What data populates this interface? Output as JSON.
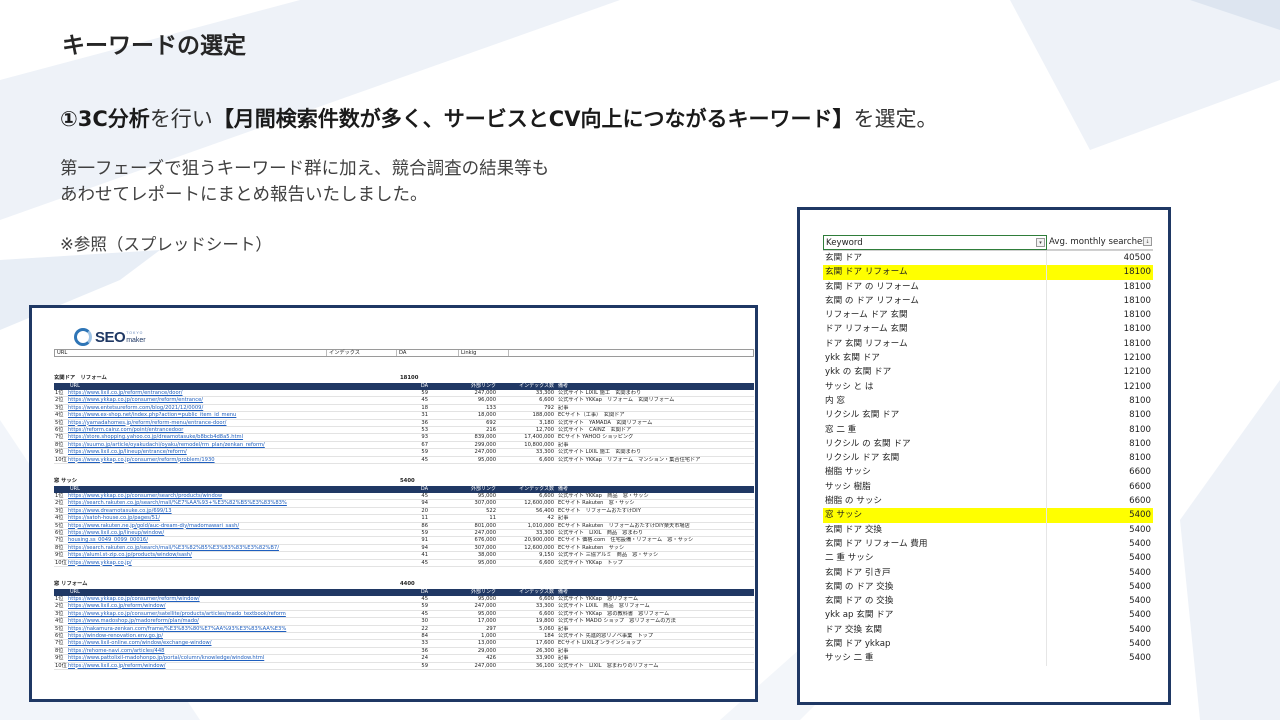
{
  "slide": {
    "title": "キーワードの選定",
    "headline": {
      "bold1": "①3C分析",
      "normal1": "を行い",
      "bold2": "【月間検索件数が多く、サービスとCV向上につながるキーワード】",
      "normal2": "を選定。"
    },
    "desc_line1": "第一フェーズで狙うキーワード群に加え、競合調査の結果等も",
    "desc_line2": "あわせてレポートにまとめ報告いたしました。",
    "note": "※参照（スプレッドシート）"
  },
  "sheet": {
    "logo_text": "SEO",
    "logo_sub": "maker",
    "logo_tiny": "TOKYO",
    "header": [
      "URL",
      "インデックス",
      "DA",
      "Linkig"
    ],
    "columns": [
      "URL",
      "DA",
      "外部リンク",
      "インデックス数",
      "備考"
    ],
    "blocks": [
      {
        "title": "玄関ドア　リフォーム",
        "volume": "18100",
        "rows": [
          [
            "1位",
            "https://www.lixil.co.jp/reform/entrance/door/",
            "59",
            "247,000",
            "33,300",
            "公式サイト LIXIL 施工　玄関まわり"
          ],
          [
            "2位",
            "https://www.ykkap.co.jp/consumer/reform/entrance/",
            "45",
            "96,000",
            "6,600",
            "公式サイト YKKap　リフォーム　玄関リフォーム"
          ],
          [
            "3位",
            "https://www.entetsureform.com/blog/2021/12/0009/",
            "18",
            "133",
            "792",
            "記事"
          ],
          [
            "4位",
            "https://www.ex-shop.net/index.php?action=public_item_id_menu",
            "31",
            "18,000",
            "188,000",
            "ECサイト（工事）　玄関ドア"
          ],
          [
            "5位",
            "https://yamadahomes.jp/reform/reform-menu/entrance-door/",
            "36",
            "692",
            "3,180",
            "公式サイト　YAMADA　玄関リフォーム"
          ],
          [
            "6位",
            "https://reform.cainz.com/point/entrancedoor",
            "53",
            "216",
            "12,700",
            "公式サイト　CAINZ　玄関ドア"
          ],
          [
            "7位",
            "https://store.shopping.yahoo.co.jp/dreamotasuke/b8bcb4d8a5.html",
            "93",
            "839,000",
            "17,400,000",
            "ECサイト YAHOO ショッピング"
          ],
          [
            "8位",
            "https://suumo.jp/article/oyakudachi/oyaku/remodel/rm_plan/zenkan_reform/",
            "67",
            "299,000",
            "10,800,000",
            "記事"
          ],
          [
            "9位",
            "https://www.lixil.co.jp/lineup/entrance/reform/",
            "59",
            "247,000",
            "33,300",
            "公式サイト LIXIL 施工　玄関まわり"
          ],
          [
            "10位",
            "https://www.ykkap.co.jp/consumer/reform/problem/1930",
            "45",
            "95,000",
            "6,600",
            "公式サイト YKKap　リフォーム　マンション・集合住宅ドア"
          ]
        ]
      },
      {
        "title": "窓 サッシ",
        "volume": "5400",
        "rows": [
          [
            "1位",
            "https://www.ykkap.co.jp/consumer/search/products/window",
            "45",
            "95,000",
            "6,600",
            "公式サイト YKKap　商品　窓・サッシ"
          ],
          [
            "2位",
            "https://search.rakuten.co.jp/search/mall/%E7%AA%93+%E3%82%B5%E3%83%83%",
            "94",
            "307,000",
            "12,600,000",
            "ECサイト Rakuten　窓・サッシ"
          ],
          [
            "3位",
            "https://www.dreamotasuke.co.jp/699/13",
            "20",
            "522",
            "56,400",
            "ECサイト　リフォームおたすけDIY"
          ],
          [
            "4位",
            "https://satoh-house.co.jp/pages/51/",
            "11",
            "11",
            "42",
            "記事"
          ],
          [
            "5位",
            "https://www.rakuten.ne.jp/gold/auc-dream-diy/madomawari_sash/",
            "86",
            "801,000",
            "1,010,000",
            "ECサイト Rakuten　リフォームおたすけDIY楽天市場店"
          ],
          [
            "6位",
            "https://www.lixil.co.jp/lineup/window/",
            "59",
            "247,000",
            "33,300",
            "公式サイト　LIXIL　商品　窓まわり"
          ],
          [
            "7位",
            "housing.ss_0049_0099_00016/",
            "91",
            "676,000",
            "20,900,000",
            "ECサイト 価格.com　住宅設備・リフォーム　窓・サッシ"
          ],
          [
            "8位",
            "https://search.rakuten.co.jp/search/mall/%E3%82%B5%E3%83%83%E3%82%B7/",
            "94",
            "307,000",
            "12,600,000",
            "ECサイト Rakuten　サッシ"
          ],
          [
            "9位",
            "https://aluml.st-zip.co.jp/products/window/sash/",
            "41",
            "38,000",
            "9,150",
            "公式サイト 三協アルミ　商品　窓・サッシ"
          ],
          [
            "10位",
            "https://www.ykkap.co.jp/",
            "45",
            "95,000",
            "6,600",
            "公式サイト YKKap　トップ"
          ]
        ]
      },
      {
        "title": "窓 リフォーム",
        "volume": "4400",
        "rows": [
          [
            "1位",
            "https://www.ykkap.co.jp/consumer/reform/window/",
            "45",
            "95,000",
            "6,600",
            "公式サイト YKKap　窓リフォーム"
          ],
          [
            "2位",
            "https://www.lixil.co.jp/reform/window/",
            "59",
            "247,000",
            "33,300",
            "公式サイト LIXIL　商品　窓リフォーム"
          ],
          [
            "3位",
            "https://www.ykkap.co.jp/consumer/satellite/products/articles/mado_textbook/reform",
            "45",
            "95,000",
            "6,600",
            "公式サイト YKKap　窓の教科書　窓リフォーム"
          ],
          [
            "4位",
            "https://www.madoshop.jp/madoreform/plan/mado/",
            "30",
            "17,000",
            "19,800",
            "公式サイト MADO ショップ　窓リフォームの方法"
          ],
          [
            "5位",
            "https://nakamura-zenkan.com/frame/%E3%83%80%E7%AA%93%E3%83%AA%E3%",
            "22",
            "297",
            "5,060",
            "記事"
          ],
          [
            "6位",
            "https://window-renovation.env.go.jp/",
            "84",
            "1,000",
            "184",
            "公式サイト 先進的窓リノベ事業　トップ"
          ],
          [
            "7位",
            "https://www.lixil-online.com/window/exchange-window/",
            "33",
            "13,000",
            "17,600",
            "ECサイト LIXILオンラインショップ"
          ],
          [
            "8位",
            "https://rehome-navi.com/articles/448",
            "36",
            "29,000",
            "26,300",
            "記事"
          ],
          [
            "9位",
            "https://www.pattolixil-madohonpo.jp/portal/column/knowledge/window.html",
            "24",
            "426",
            "33,900",
            "記事"
          ],
          [
            "10位",
            "https://www.lixil.co.jp/reform/window/",
            "59",
            "247,000",
            "36,100",
            "公式サイト　LIXIL　窓まわりのリフォーム"
          ]
        ]
      }
    ]
  },
  "keywords": {
    "header_keyword": "Keyword",
    "header_volume": "Avg. monthly searches",
    "highlight_color": "#ffff00",
    "rows": [
      {
        "k": "玄関 ドア",
        "v": "40500",
        "hl": false
      },
      {
        "k": "玄関 ドア リフォーム",
        "v": "18100",
        "hl": true
      },
      {
        "k": "玄関 ドア の リフォーム",
        "v": "18100",
        "hl": false
      },
      {
        "k": "玄関 の ドア リフォーム",
        "v": "18100",
        "hl": false
      },
      {
        "k": "リフォーム ドア 玄関",
        "v": "18100",
        "hl": false
      },
      {
        "k": "ドア リフォーム 玄関",
        "v": "18100",
        "hl": false
      },
      {
        "k": "ドア 玄関 リフォーム",
        "v": "18100",
        "hl": false
      },
      {
        "k": "ykk 玄関 ドア",
        "v": "12100",
        "hl": false
      },
      {
        "k": "ykk の 玄関 ドア",
        "v": "12100",
        "hl": false
      },
      {
        "k": "サッシ と は",
        "v": "12100",
        "hl": false
      },
      {
        "k": "内 窓",
        "v": "8100",
        "hl": false
      },
      {
        "k": "リクシル 玄関 ドア",
        "v": "8100",
        "hl": false
      },
      {
        "k": "窓 二 重",
        "v": "8100",
        "hl": false
      },
      {
        "k": "リクシル の 玄関 ドア",
        "v": "8100",
        "hl": false
      },
      {
        "k": "リクシル ドア 玄関",
        "v": "8100",
        "hl": false
      },
      {
        "k": "樹脂 サッシ",
        "v": "6600",
        "hl": false
      },
      {
        "k": "サッシ 樹脂",
        "v": "6600",
        "hl": false
      },
      {
        "k": "樹脂 の サッシ",
        "v": "6600",
        "hl": false
      },
      {
        "k": "窓 サッシ",
        "v": "5400",
        "hl": true
      },
      {
        "k": "玄関 ドア 交換",
        "v": "5400",
        "hl": false
      },
      {
        "k": "玄関 ドア リフォーム 費用",
        "v": "5400",
        "hl": false
      },
      {
        "k": "二 重 サッシ",
        "v": "5400",
        "hl": false
      },
      {
        "k": "玄関 ドア 引き戸",
        "v": "5400",
        "hl": false
      },
      {
        "k": "玄関 の ドア 交換",
        "v": "5400",
        "hl": false
      },
      {
        "k": "玄関 ドア の 交換",
        "v": "5400",
        "hl": false
      },
      {
        "k": "ykk ap 玄関 ドア",
        "v": "5400",
        "hl": false
      },
      {
        "k": "ドア 交換 玄関",
        "v": "5400",
        "hl": false
      },
      {
        "k": "玄関 ドア ykkap",
        "v": "5400",
        "hl": false
      },
      {
        "k": "サッシ 二 重",
        "v": "5400",
        "hl": false
      }
    ]
  }
}
